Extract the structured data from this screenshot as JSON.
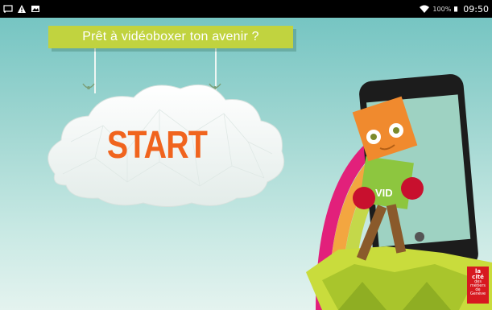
{
  "status_bar": {
    "battery_percent": "100%",
    "time": "09:50",
    "icons": [
      "cast-icon",
      "warning-icon",
      "image-icon",
      "wifi-icon",
      "battery-icon"
    ]
  },
  "banner": {
    "title": "Prêt à vidéoboxer ton avenir ?"
  },
  "start_button": {
    "label": "START"
  },
  "mascot": {
    "shirt_text": "VID"
  },
  "logo": {
    "line1": "la cité",
    "line2": "des métiers",
    "line3": "de Genève"
  },
  "colors": {
    "accent_banner": "#c1d33f",
    "start_text": "#f0641e",
    "logo_red": "#d71920"
  }
}
